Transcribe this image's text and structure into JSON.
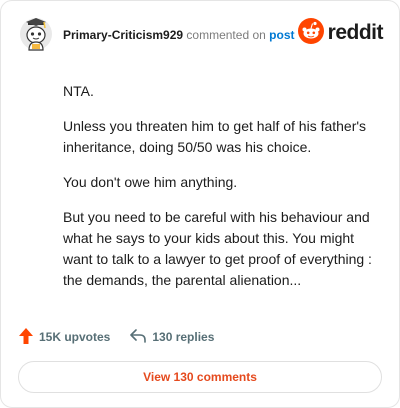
{
  "header": {
    "username": "Primary-Criticism929",
    "verb": "commented on",
    "post_link": "post",
    "brand_name": "reddit",
    "avatar_icon": "snoo-avatar-icon",
    "brand_icon": "reddit-logo-icon"
  },
  "comment": {
    "paragraphs": [
      "NTA.",
      "Unless you threaten him to get half of his father's inheritance, doing 50/50 was his choice.",
      "You don't owe him anything.",
      "But you need to be careful with his behaviour and what he says to your kids about this. You might want to talk to a lawyer to get proof of everything : the demands, the parental alienation..."
    ]
  },
  "actions": {
    "upvotes_label": "15K upvotes",
    "replies_label": "130 replies",
    "upvote_icon": "upvote-arrow-icon",
    "reply_icon": "reply-arrow-icon"
  },
  "footer": {
    "view_comments_label": "View 130 comments"
  },
  "colors": {
    "reddit_orange": "#ff4500",
    "link_blue": "#0079d3",
    "button_text": "#e54a1e"
  }
}
